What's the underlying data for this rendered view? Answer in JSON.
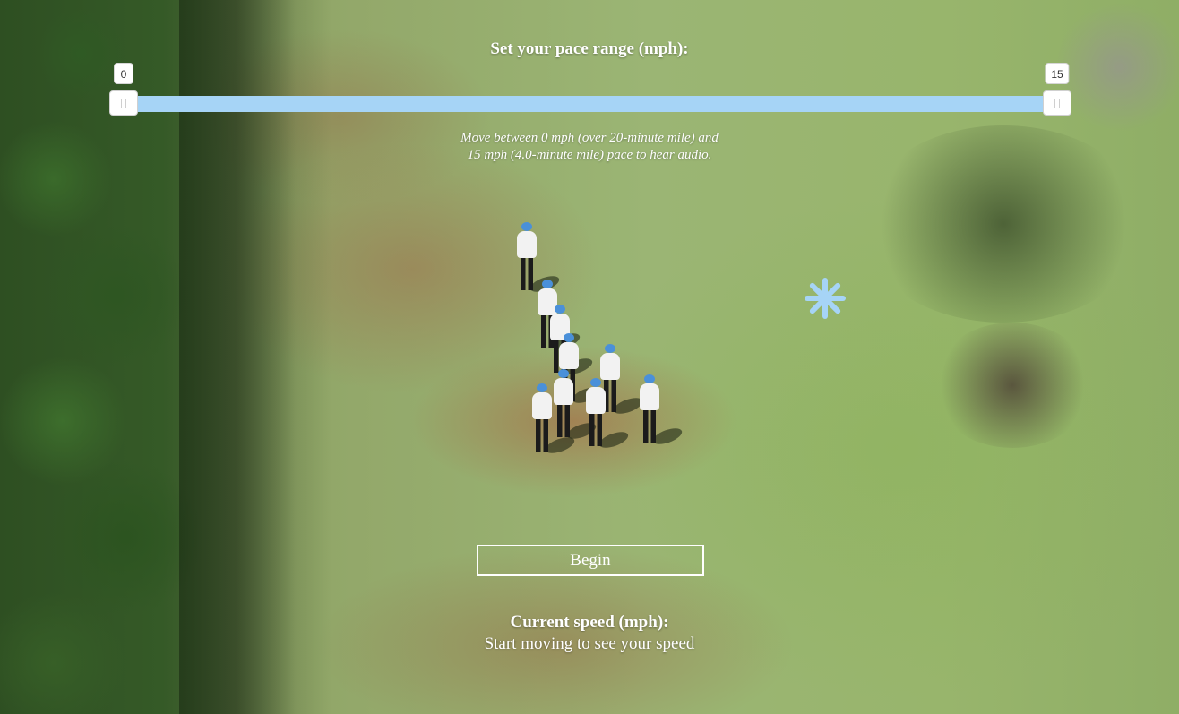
{
  "pace_range": {
    "title": "Set your pace range (mph):",
    "min": 0,
    "max": 15,
    "low_value": "0",
    "high_value": "15",
    "track_color": "#aed8f7"
  },
  "hint": {
    "line1": "Move between 0 mph (over 20-minute mile) and",
    "line2": "15 mph (4.0-minute mile) pace to hear audio."
  },
  "loader": {
    "icon": "asterisk-icon",
    "color": "#a6d4f6"
  },
  "begin_button": {
    "label": "Begin"
  },
  "current_speed": {
    "label": "Current speed (mph):",
    "value": "Start moving to see your speed"
  }
}
